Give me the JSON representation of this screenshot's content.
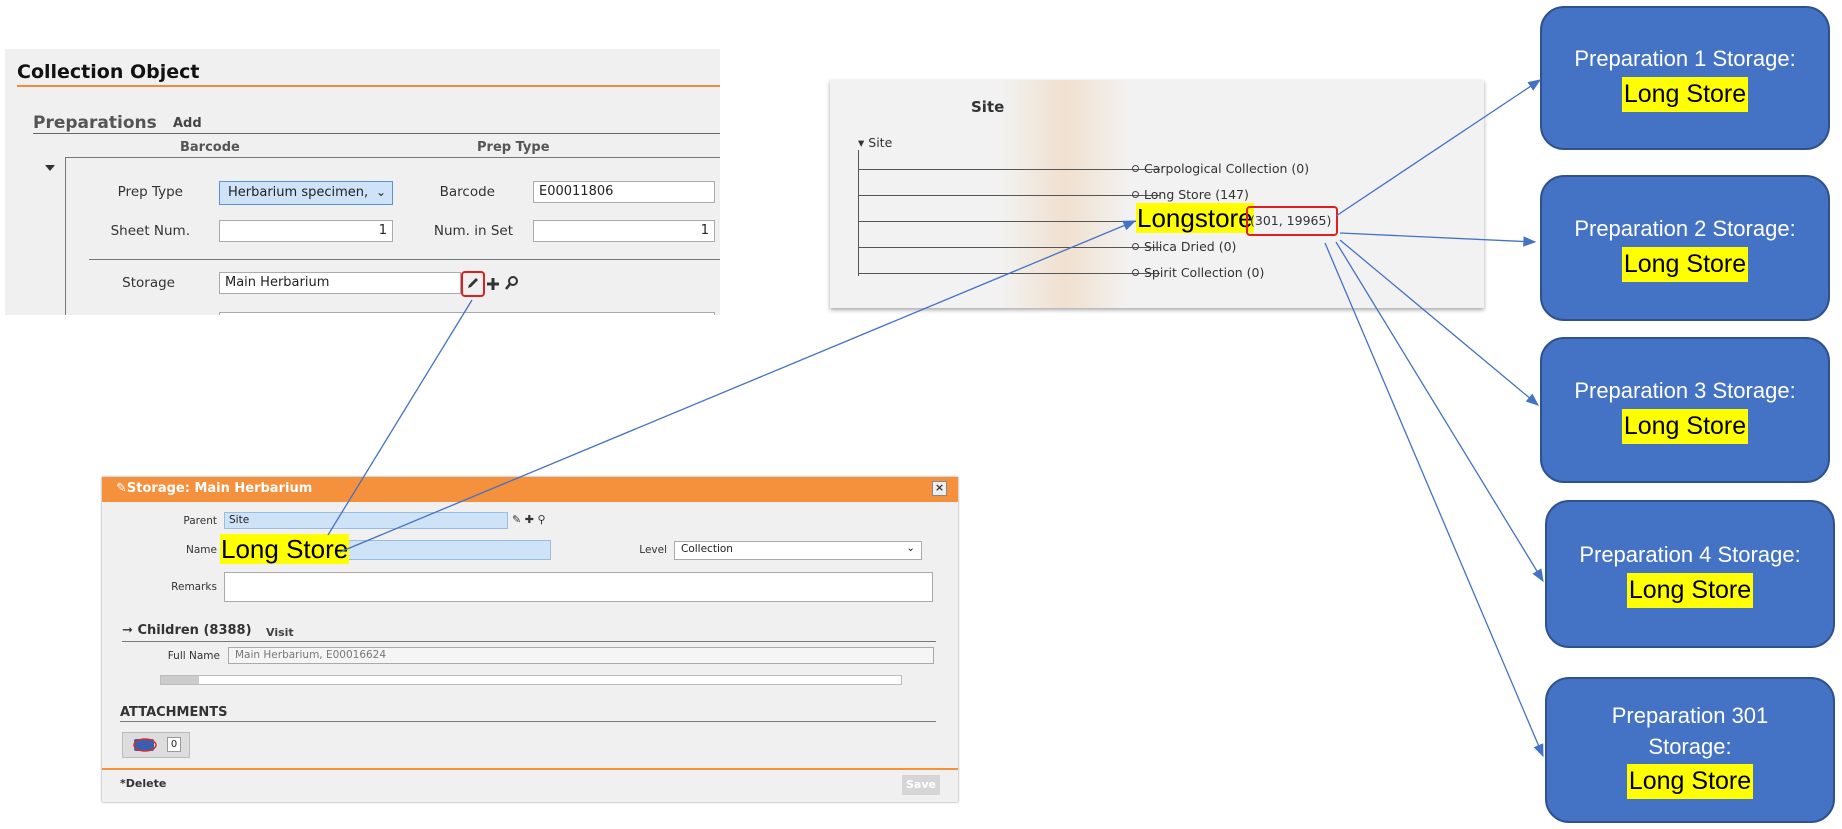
{
  "collection_object": {
    "title": "Collection Object",
    "preparations_label": "Preparations",
    "add_label": "Add",
    "col_barcode": "Barcode",
    "col_prep_type": "Prep Type",
    "prep_type_label": "Prep Type",
    "prep_type_value": "Herbarium specimen,",
    "barcode_label": "Barcode",
    "barcode_value": "E00011806",
    "sheet_num_label": "Sheet Num.",
    "sheet_num_value": "1",
    "num_in_set_label": "Num. in Set",
    "num_in_set_value": "1",
    "storage_label": "Storage",
    "storage_value": "Main Herbarium"
  },
  "site_tree": {
    "title": "Site",
    "root": "Site",
    "nodes": [
      "Carpological Collection (0)",
      "Long Store (147)",
      "Longstore",
      "Silica Dried (0)",
      "Spirit Collection (0)"
    ],
    "longstore_count": "(301, 19965)"
  },
  "storage_dialog": {
    "title": "Storage: Main Herbarium",
    "parent_label": "Parent",
    "parent_value": "Site",
    "name_label": "Name",
    "name_value": "Long Store",
    "level_label": "Level",
    "level_value": "Collection",
    "remarks_label": "Remarks",
    "children_label": "Children (8388)",
    "visit_label": "Visit",
    "full_name_label": "Full Name",
    "full_name_value": "Main Herbarium, E00016624",
    "attachments_label": "ATTACHMENTS",
    "attach_count": "0",
    "delete_label": "*Delete",
    "save_label": "Save"
  },
  "cards": [
    {
      "title": "Preparation 1 Storage:",
      "value": "Long Store"
    },
    {
      "title": "Preparation 2 Storage:",
      "value": "Long Store"
    },
    {
      "title": "Preparation 3 Storage:",
      "value": "Long Store"
    },
    {
      "title": "Preparation 4 Storage:",
      "value": "Long Store"
    },
    {
      "title": "Preparation 301 Storage:",
      "value": "Long Store"
    }
  ],
  "colors": {
    "accent_orange": "#f5913d",
    "card_blue": "#4472c4",
    "highlight_yellow": "#ffff00",
    "highlight_red": "#e02020",
    "arrow_blue": "#4472c4"
  },
  "icons": [
    "edit-pencil-icon",
    "plus-icon",
    "magnifier-icon",
    "caret-down-icon",
    "close-icon",
    "attachment-icon"
  ]
}
